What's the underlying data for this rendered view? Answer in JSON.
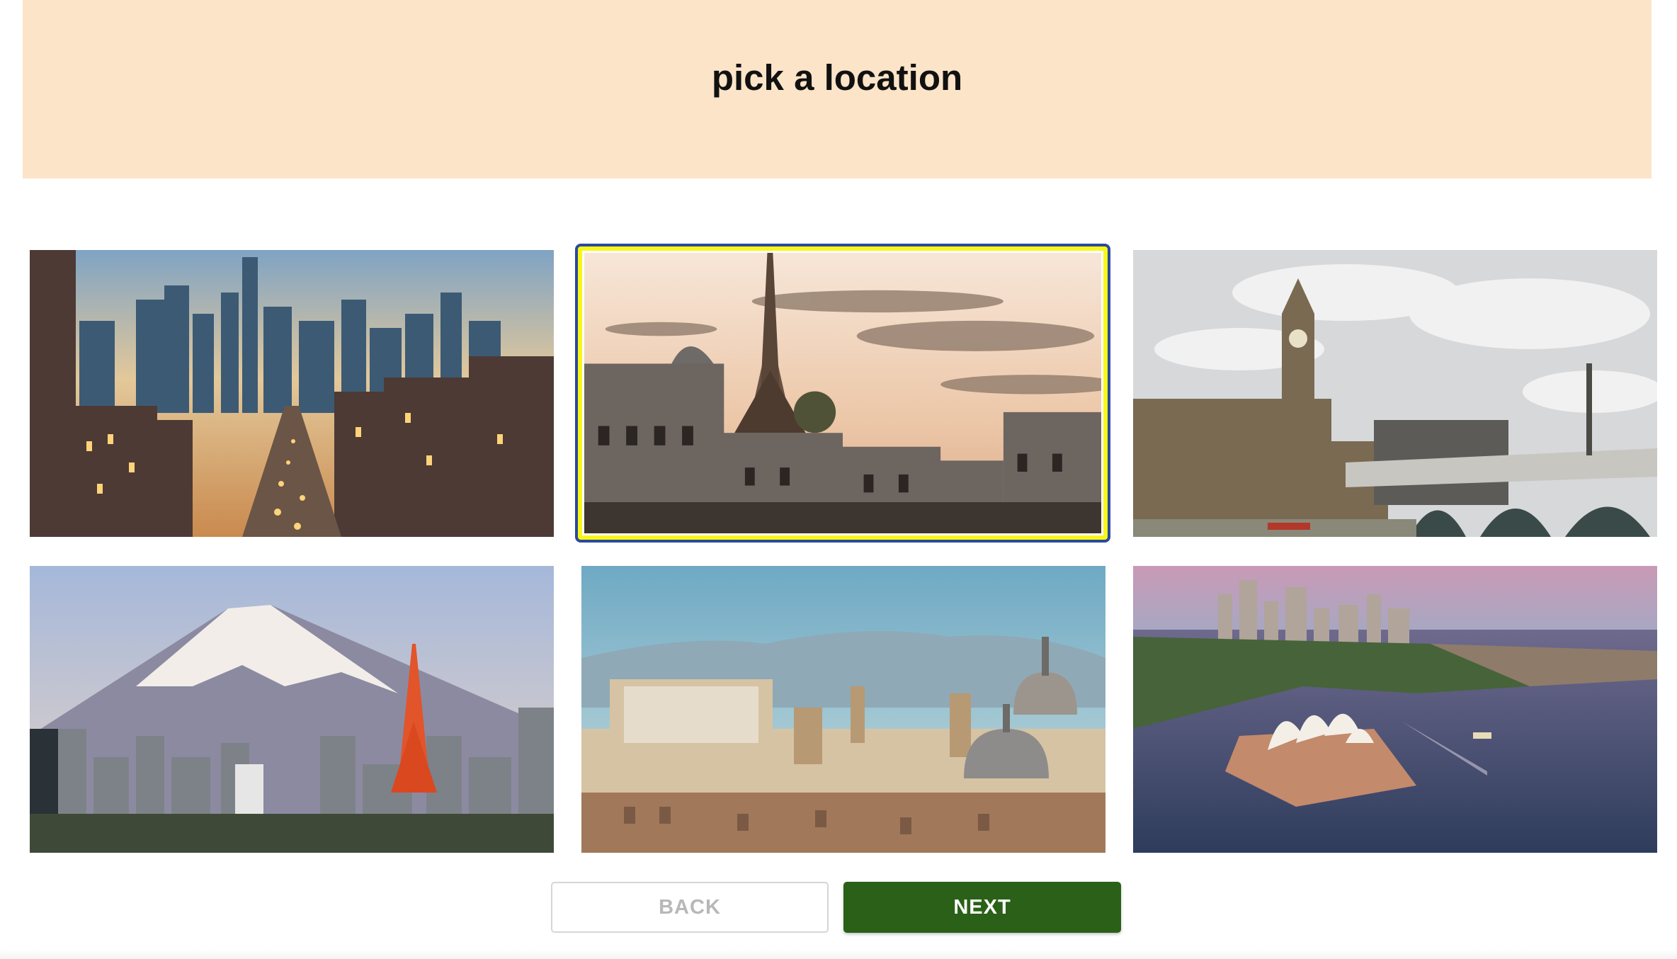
{
  "header": {
    "title": "pick a location",
    "background_color": "#fce4c8"
  },
  "locations": [
    {
      "city": "New York",
      "image": "new-york-skyline-photo",
      "selected": false
    },
    {
      "city": "Paris",
      "image": "paris-eiffel-tower-photo",
      "selected": true
    },
    {
      "city": "London",
      "image": "london-big-ben-photo",
      "selected": false
    },
    {
      "city": "Tokyo",
      "image": "tokyo-mount-fuji-photo",
      "selected": false
    },
    {
      "city": "Rome",
      "image": "rome-cityscape-photo",
      "selected": false
    },
    {
      "city": "Sydney",
      "image": "sydney-opera-house-photo",
      "selected": false
    }
  ],
  "selection_style": {
    "border_color": "#2b4a9c",
    "highlight_color": "#f7f71a"
  },
  "navigation": {
    "back_label": "BACK",
    "back_enabled": false,
    "next_label": "NEXT",
    "next_color": "#2a6018"
  }
}
